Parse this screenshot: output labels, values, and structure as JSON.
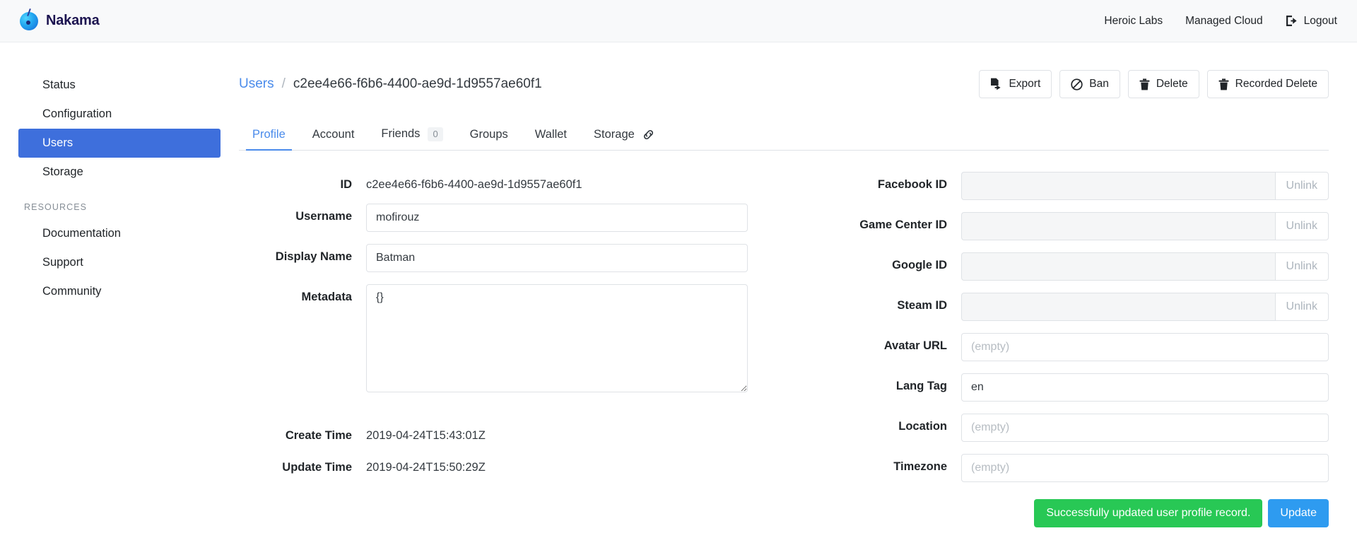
{
  "brand": {
    "name": "Nakama",
    "logo_icon": "nakama-logo-icon"
  },
  "navbar": {
    "links": [
      {
        "label": "Heroic Labs",
        "icon": null
      },
      {
        "label": "Managed Cloud",
        "icon": null
      },
      {
        "label": "Logout",
        "icon": "sign-out-icon"
      }
    ]
  },
  "sidebar": {
    "items": [
      {
        "label": "Status",
        "active": false
      },
      {
        "label": "Configuration",
        "active": false
      },
      {
        "label": "Users",
        "active": true
      },
      {
        "label": "Storage",
        "active": false
      }
    ],
    "resources_heading": "RESOURCES",
    "resources": [
      {
        "label": "Documentation"
      },
      {
        "label": "Support"
      },
      {
        "label": "Community"
      }
    ]
  },
  "breadcrumb": {
    "root": "Users",
    "separator": "/",
    "current": "c2ee4e66-f6b6-4400-ae9d-1d9557ae60f1"
  },
  "actions": [
    {
      "label": "Export",
      "icon": "file-export-icon"
    },
    {
      "label": "Ban",
      "icon": "ban-icon"
    },
    {
      "label": "Delete",
      "icon": "trash-icon"
    },
    {
      "label": "Recorded Delete",
      "icon": "trash-icon"
    }
  ],
  "tabs": [
    {
      "label": "Profile",
      "active": true,
      "badge": null,
      "icon": null
    },
    {
      "label": "Account",
      "active": false,
      "badge": null,
      "icon": null
    },
    {
      "label": "Friends",
      "active": false,
      "badge": "0",
      "icon": null
    },
    {
      "label": "Groups",
      "active": false,
      "badge": null,
      "icon": null
    },
    {
      "label": "Wallet",
      "active": false,
      "badge": null,
      "icon": null
    },
    {
      "label": "Storage",
      "active": false,
      "badge": null,
      "icon": "link-icon"
    }
  ],
  "profile": {
    "left": {
      "id_label": "ID",
      "id_value": "c2ee4e66-f6b6-4400-ae9d-1d9557ae60f1",
      "username_label": "Username",
      "username_value": "mofirouz",
      "display_name_label": "Display Name",
      "display_name_value": "Batman",
      "metadata_label": "Metadata",
      "metadata_value": "{}",
      "create_time_label": "Create Time",
      "create_time_value": "2019-04-24T15:43:01Z",
      "update_time_label": "Update Time",
      "update_time_value": "2019-04-24T15:50:29Z"
    },
    "right": {
      "facebook_label": "Facebook ID",
      "facebook_value": "",
      "game_center_label": "Game Center ID",
      "game_center_value": "",
      "google_label": "Google ID",
      "google_value": "",
      "steam_label": "Steam ID",
      "steam_value": "",
      "unlink_label": "Unlink",
      "avatar_label": "Avatar URL",
      "avatar_value": "",
      "avatar_placeholder": "(empty)",
      "lang_label": "Lang Tag",
      "lang_value": "en",
      "location_label": "Location",
      "location_value": "",
      "location_placeholder": "(empty)",
      "timezone_label": "Timezone",
      "timezone_value": "",
      "timezone_placeholder": "(empty)"
    },
    "status_message": "Successfully updated user profile record.",
    "update_button": "Update"
  },
  "colors": {
    "accent_blue": "#3e6fdc",
    "link_blue": "#4a8beb",
    "success_green": "#28c855",
    "update_blue": "#2e9bf0",
    "navbar_bg": "#f8f9fa"
  }
}
